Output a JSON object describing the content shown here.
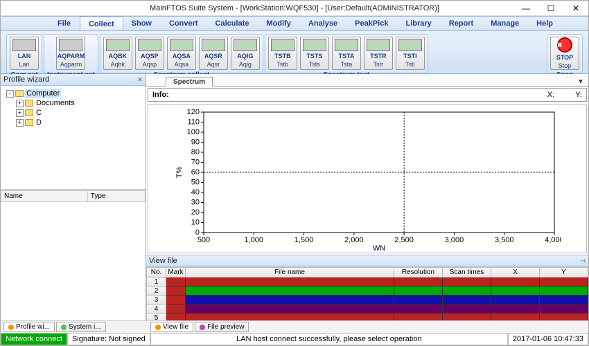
{
  "title": "MainFTOS Suite System - [WorkStation:WQF530] - [User:Default(ADMINISTRATOR)]",
  "menu": [
    "File",
    "Collect",
    "Show",
    "Convert",
    "Calculate",
    "Modify",
    "Analyse",
    "PeakPick",
    "Library",
    "Report",
    "Manage",
    "Help"
  ],
  "menu_active": 1,
  "ribbon": {
    "com_set": {
      "label": "Com set",
      "items": [
        {
          "big": "LAN",
          "small": "Lan"
        }
      ]
    },
    "instrument_set": {
      "label": "Instrument set",
      "items": [
        {
          "big": "AQPARM",
          "small": "Aqparm"
        }
      ]
    },
    "spectrum_collect": {
      "label": "Spectrum collect",
      "items": [
        {
          "big": "AQBK",
          "small": "Aqbk"
        },
        {
          "big": "AQSP",
          "small": "Aqsp"
        },
        {
          "big": "AQSA",
          "small": "Aqsa"
        },
        {
          "big": "AQSR",
          "small": "Aqsr"
        },
        {
          "big": "AQIG",
          "small": "Aqig"
        }
      ]
    },
    "spectrum_test": {
      "label": "Spectrum test",
      "items": [
        {
          "big": "TSTB",
          "small": "Tstb"
        },
        {
          "big": "TSTS",
          "small": "Tsts"
        },
        {
          "big": "TSTA",
          "small": "Tsta"
        },
        {
          "big": "TSTR",
          "small": "Tstr"
        },
        {
          "big": "TSTI",
          "small": "Tsti"
        }
      ]
    },
    "scan": {
      "label": "Scan",
      "items": [
        {
          "big": "STOP",
          "small": "Stop"
        }
      ]
    }
  },
  "profile_wizard": {
    "title": "Profile wizard",
    "tree": [
      {
        "expander": "-",
        "icon": "drive",
        "label": "Computer",
        "indent": 0,
        "sel": true
      },
      {
        "expander": "+",
        "icon": "drive",
        "label": "Documents",
        "indent": 1
      },
      {
        "expander": "+",
        "icon": "drive",
        "label": "C",
        "indent": 1
      },
      {
        "expander": "+",
        "icon": "drive",
        "label": "D",
        "indent": 1
      }
    ],
    "cols": [
      "Name",
      "Type"
    ]
  },
  "spectrum_tab": "Spectrum",
  "info": {
    "label": "Info:",
    "x": "X:",
    "y": "Y:"
  },
  "chart_data": {
    "type": "line",
    "title": "",
    "xlabel": "WN",
    "ylabel": "T%",
    "xlim": [
      500,
      4000
    ],
    "ylim": [
      0,
      120
    ],
    "x_ticks": [
      4000,
      3500,
      3000,
      2500,
      2000,
      1500,
      1000,
      500
    ],
    "y_ticks": [
      0,
      10,
      20,
      30,
      40,
      50,
      60,
      70,
      80,
      90,
      100,
      110,
      120
    ],
    "x_reversed": true,
    "crosshair": {
      "x": 2500,
      "y": 60
    },
    "series": []
  },
  "viewfile": {
    "title": "View file",
    "cols": [
      "No.",
      "Mark",
      "File name",
      "Resolution",
      "Scan times",
      "X",
      "Y"
    ],
    "rows": [
      {
        "no": "1",
        "cls": "r-red"
      },
      {
        "no": "2",
        "cls": "r-green"
      },
      {
        "no": "3",
        "cls": "r-blue"
      },
      {
        "no": "4",
        "cls": "r-purple"
      },
      {
        "no": "5",
        "cls": "r-red"
      }
    ]
  },
  "bottom_tabs": {
    "left": [
      {
        "label": "Profile wi...",
        "active": true
      },
      {
        "label": "System i..."
      }
    ],
    "right": [
      {
        "label": "View file",
        "active": true
      },
      {
        "label": "File preview"
      }
    ]
  },
  "status": {
    "connect": "Network connect",
    "signature": "Signature: Not signed",
    "message": "LAN host connect successfully, please select operation",
    "time": "2017-01-06 10:47:33"
  }
}
